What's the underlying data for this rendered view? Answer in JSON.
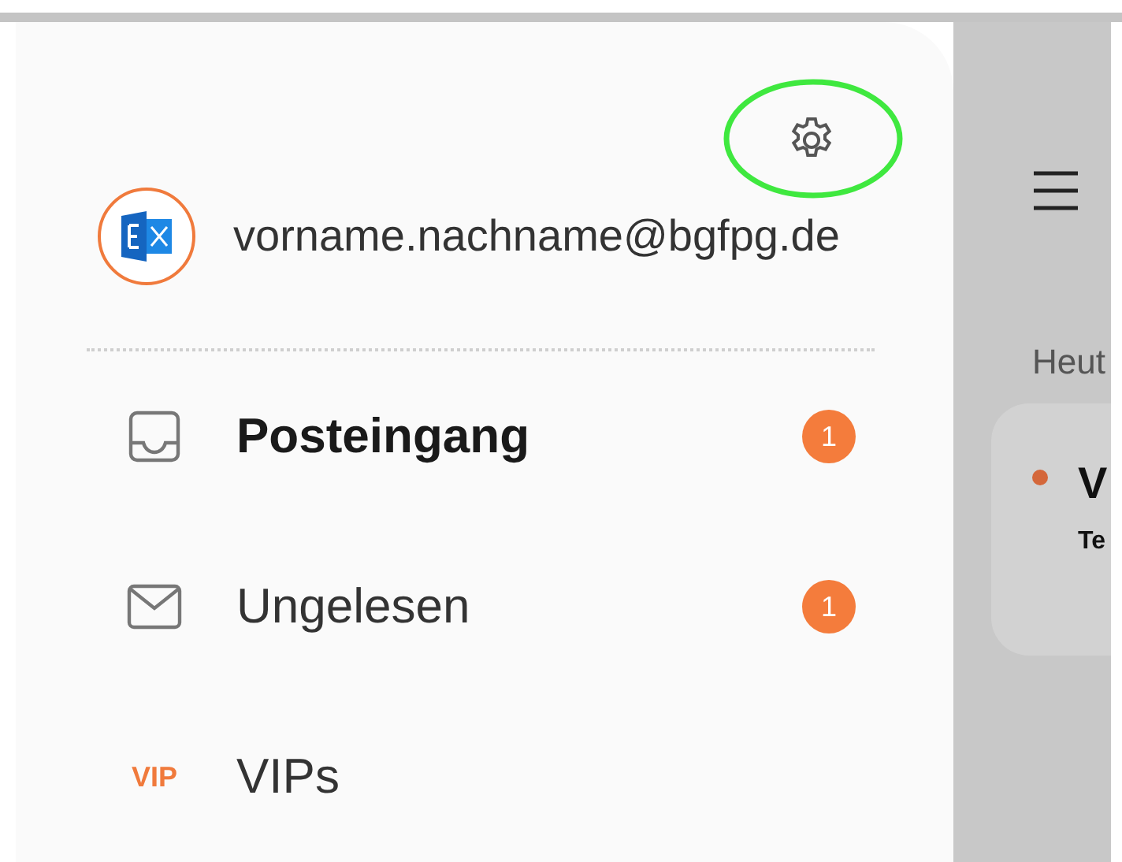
{
  "drawer": {
    "account": {
      "email": "vorname.nachname@bgfpg.de"
    },
    "folders": [
      {
        "kind": "inbox",
        "label": "Posteingang",
        "selected": true,
        "badge": "1"
      },
      {
        "kind": "unread",
        "label": "Ungelesen",
        "selected": false,
        "badge": "1"
      },
      {
        "kind": "vip",
        "icon_text": "VIP",
        "label": "VIPs",
        "selected": false
      }
    ]
  },
  "mail_list": {
    "section": "Heut",
    "message": {
      "unread": true,
      "title": "V",
      "subtitle": "Te"
    }
  }
}
